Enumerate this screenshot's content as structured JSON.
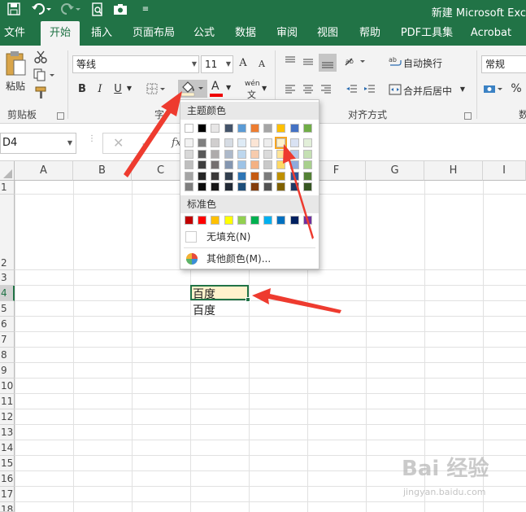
{
  "window": {
    "title": "新建 Microsoft Exc"
  },
  "quick_access": [
    "save-icon",
    "undo-icon",
    "redo-icon",
    "print-preview-icon",
    "camera-icon",
    "customize-icon"
  ],
  "tabs": [
    {
      "label": "文件"
    },
    {
      "label": "开始"
    },
    {
      "label": "插入"
    },
    {
      "label": "页面布局"
    },
    {
      "label": "公式"
    },
    {
      "label": "数据"
    },
    {
      "label": "审阅"
    },
    {
      "label": "视图"
    },
    {
      "label": "帮助"
    },
    {
      "label": "PDF工具集"
    },
    {
      "label": "Acrobat"
    }
  ],
  "ribbon": {
    "paste_label": "粘贴",
    "clipboard_group": "剪贴板",
    "font_group_partial": "字",
    "font_name": "等线",
    "font_size": "11",
    "bold": "B",
    "italic": "I",
    "underline": "U",
    "grow_font": "A",
    "shrink_font": "A",
    "font_color_label": "A",
    "phonetic": "wén",
    "wrap_text": "自动换行",
    "merge_center": "合并后居中",
    "alignment_group": "对齐方式",
    "number_format": "常规",
    "percent": "%",
    "number_group_partial": "数"
  },
  "formula_bar": {
    "name_box": "D4",
    "fx": "fx"
  },
  "columns": [
    "A",
    "B",
    "C",
    "D",
    "E",
    "F",
    "G",
    "H",
    "I"
  ],
  "rows": [
    "1",
    "2",
    "3",
    "4",
    "5",
    "6",
    "7",
    "8",
    "9",
    "10",
    "11",
    "12",
    "13",
    "14",
    "15",
    "16",
    "17",
    "18"
  ],
  "cells": {
    "D4": "百度",
    "D5": "百度"
  },
  "color_menu": {
    "theme_header": "主题颜色",
    "standard_header": "标准色",
    "no_fill": "无填充(N)",
    "more_colors": "其他颜色(M)...",
    "theme_top": [
      "#ffffff",
      "#000000",
      "#e7e6e6",
      "#44546a",
      "#5b9bd5",
      "#ed7d31",
      "#a5a5a5",
      "#ffc000",
      "#4472c4",
      "#70ad47"
    ],
    "theme_shades": [
      [
        "#f2f2f2",
        "#7f7f7f",
        "#d0cece",
        "#d6dce4",
        "#deebf6",
        "#fbe5d5",
        "#ededed",
        "#fff2cc",
        "#d9e2f3",
        "#e2efd9"
      ],
      [
        "#d8d8d8",
        "#595959",
        "#aeabab",
        "#adb9ca",
        "#bdd7ee",
        "#f7cbac",
        "#dbdbdb",
        "#fee599",
        "#b4c6e7",
        "#c5e0b3"
      ],
      [
        "#bfbfbf",
        "#3f3f3f",
        "#757070",
        "#8496b0",
        "#9dc3e6",
        "#f4b183",
        "#c9c9c9",
        "#ffd965",
        "#8eaadb",
        "#a8d08d"
      ],
      [
        "#a5a5a5",
        "#262626",
        "#3a3838",
        "#323f4f",
        "#2e75b5",
        "#c55a11",
        "#7b7b7b",
        "#bf9000",
        "#2f5496",
        "#538135"
      ],
      [
        "#7f7f7f",
        "#0c0c0c",
        "#171616",
        "#222a35",
        "#1e4e79",
        "#833c0b",
        "#525252",
        "#7f6000",
        "#1f3864",
        "#375623"
      ]
    ],
    "standard": [
      "#c00000",
      "#ff0000",
      "#ffc000",
      "#ffff00",
      "#92d050",
      "#00b050",
      "#00b0f0",
      "#0070c0",
      "#002060",
      "#7030a0"
    ],
    "selected_color": "#fff2cc"
  },
  "watermark": {
    "text": "Bai 经验",
    "url": "jingyan.baidu.com"
  },
  "colors": {
    "accent": "#217346",
    "arrow": "#ee3b2f"
  }
}
